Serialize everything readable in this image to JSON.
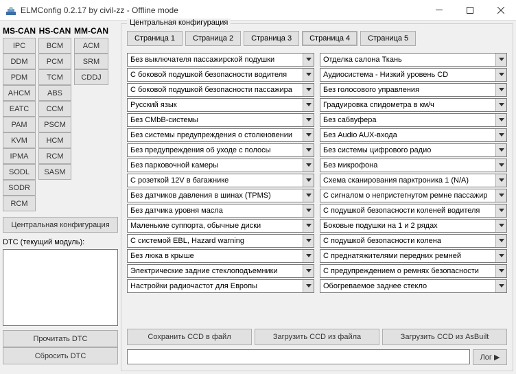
{
  "window": {
    "title": "ELMConfig 0.2.17 by civil-zz - Offline mode"
  },
  "left": {
    "cols": [
      {
        "head": "MS-CAN",
        "items": [
          "IPC",
          "DDM",
          "PDM",
          "AHCM",
          "EATC",
          "PAM",
          "KVM",
          "IPMA",
          "SODL",
          "SODR",
          "RCM"
        ]
      },
      {
        "head": "HS-CAN",
        "items": [
          "BCM",
          "PCM",
          "TCM",
          "ABS",
          "CCM",
          "PSCM",
          "HCM",
          "RCM",
          "SASM"
        ]
      },
      {
        "head": "MM-CAN",
        "items": [
          "ACM",
          "SRM",
          "CDDJ"
        ]
      }
    ],
    "cc_btn": "Центральная конфигурация",
    "dtc_label": "DTC (текущий модуль):",
    "read_dtc": "Прочитать DTC",
    "reset_dtc": "Сбросить DTC"
  },
  "main": {
    "legend": "Центральная конфигурация",
    "tabs": [
      "Страница 1",
      "Страница 2",
      "Страница 3",
      "Страница 4",
      "Страница 5"
    ],
    "active_tab": 3,
    "rows": [
      [
        "Без выключателя пассажирской подушки",
        "Отделка салона Ткань"
      ],
      [
        "С боковой подушкой безопасности водителя",
        "Аудиосистема - Низкий уровень CD"
      ],
      [
        "С боковой подушкой безопасности пассажира",
        "Без голосового управления"
      ],
      [
        "Русский язык",
        "Градуировка спидометра в км/ч"
      ],
      [
        "Без CMbB-системы",
        "Без сабвуфера"
      ],
      [
        "Без системы предупреждения о столкновении",
        "Без Audio AUX-входа"
      ],
      [
        "Без предупреждения об уходе с полосы",
        "Без системы цифрового радио"
      ],
      [
        "Без парковочной камеры",
        "Без микрофона"
      ],
      [
        "С розеткой 12V в багажнике",
        "Схема сканирования парктроника 1 (N/A)"
      ],
      [
        "Без датчиков давления в шинах (TPMS)",
        "С сигналом о непристегнутом ремне пассажир"
      ],
      [
        "Без датчика уровня масла",
        "С подушкой безопасности коленей водителя"
      ],
      [
        "Маленькие суппорта, обычные диски",
        "Боковые подушки на 1 и 2 рядах"
      ],
      [
        "С системой EBL, Hazard warning",
        "С подушкой безопасности колена"
      ],
      [
        "Без люка в крыше",
        "С преднатяжителями передних ремней"
      ],
      [
        "Электрические задние стеклоподъемники",
        "С предупреждением о ремнях безопасности"
      ],
      [
        "Настройки радиочастот для Европы",
        "Обогреваемое заднее стекло"
      ]
    ],
    "ccd": {
      "save": "Сохранить CCD в файл",
      "load": "Загрузить CCD из файла",
      "asbuilt": "Загрузить CCD из AsBuilt"
    },
    "log_btn": "Лог ▶"
  }
}
